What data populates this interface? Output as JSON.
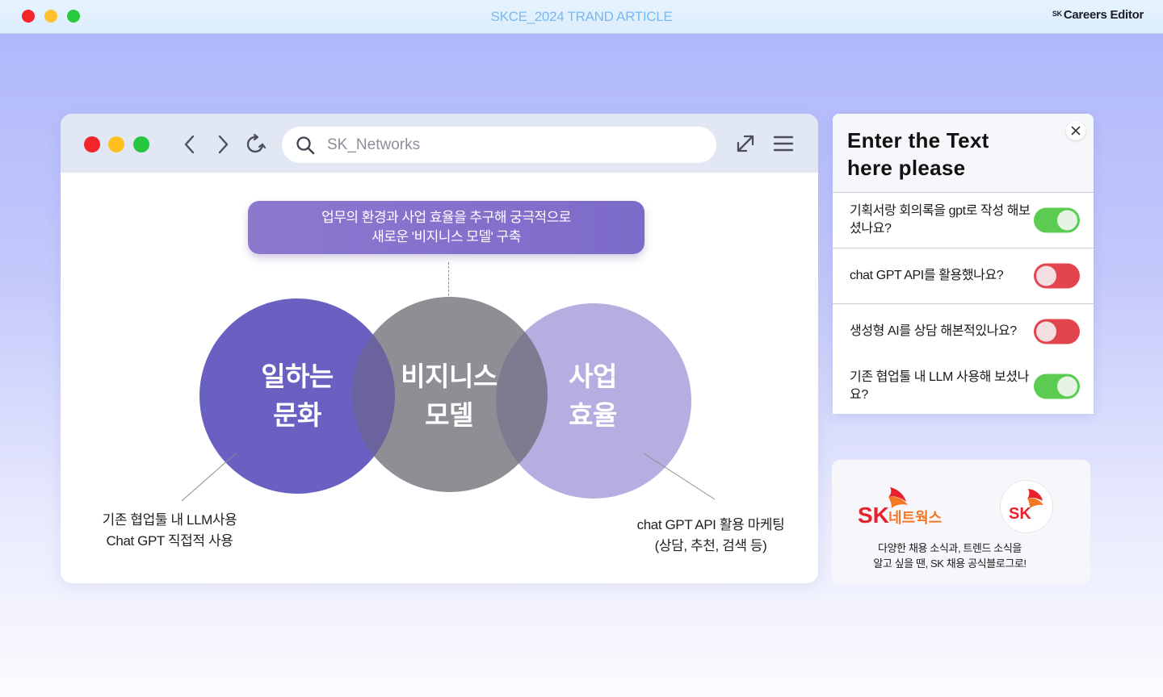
{
  "window": {
    "title": "SKCE_2024 TRAND ARTICLE",
    "brand_prefix": "SK",
    "brand_name": "Careers Editor"
  },
  "browser": {
    "url_value": "SK_Networks",
    "icons": [
      "back-icon",
      "forward-icon",
      "refresh-icon",
      "search-icon",
      "expand-icon",
      "menu-icon"
    ]
  },
  "diagram": {
    "callout_line1": "업무의 환경과 사업 효율을 추구해 궁극적으로",
    "callout_line2": "새로운 '비지니스 모델' 구축",
    "circles": [
      {
        "line1": "일하는",
        "line2": "문화",
        "color": "#6a60c2"
      },
      {
        "line1": "비지니스",
        "line2": "모델",
        "color": "#8a8990"
      },
      {
        "line1": "사업",
        "line2": "효율",
        "color": "#b7ade0"
      }
    ],
    "left_caption_line1": "기존 협업툴 내 LLM사용",
    "left_caption_line2": "Chat GPT 직접적 사용",
    "right_caption_line1": "chat GPT API 활용 마케팅",
    "right_caption_line2": "(상담, 추천, 검색 등)"
  },
  "panel": {
    "title_line1": "Enter the Text",
    "title_line2": "here please",
    "questions": [
      {
        "text": "기획서랑 회의록을 gpt로 작성 해보셨나요?",
        "toggle": "on"
      },
      {
        "text": "chat GPT API를 활용했나요?",
        "toggle": "off"
      },
      {
        "text": "생성형 AI를 상담 해본적있나요?",
        "toggle": "off"
      },
      {
        "text": "기존 협업툴 내 LLM 사용해 보셨나요?",
        "toggle": "on"
      }
    ]
  },
  "sk_card": {
    "logo_text": "SK",
    "logo_subtext": "네트웍스",
    "circle_logo_text": "SK",
    "line1": "다양한 채용 소식과, 트렌드 소식을",
    "line2": "알고 싶을 땐, SK 채용 공식블로그로!"
  },
  "colors": {
    "accent_purple": "#7d6bc9",
    "toggle_on": "#5ccb52",
    "toggle_off": "#e2454e",
    "sk_red": "#e8212e",
    "sk_orange": "#f47725"
  }
}
